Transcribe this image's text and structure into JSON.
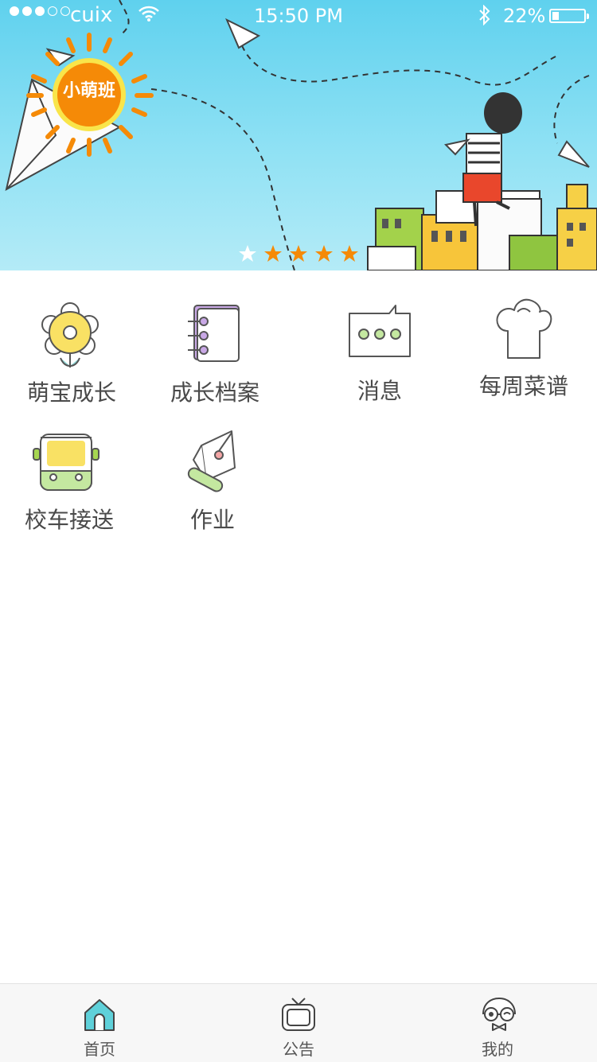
{
  "status_bar": {
    "carrier": "cuix",
    "time": "15:50 PM",
    "battery": "22%",
    "battery_level": 0.22
  },
  "banner": {
    "class_name": "小萌班",
    "pager": {
      "count": 5,
      "active_index": 0
    }
  },
  "menu": [
    {
      "label": "萌宝成长",
      "icon": "flower-icon"
    },
    {
      "label": "成长档案",
      "icon": "notebook-icon"
    },
    {
      "label": "消息",
      "icon": "message-icon"
    },
    {
      "label": "每周菜谱",
      "icon": "chef-hat-icon"
    },
    {
      "label": "校车接送",
      "icon": "school-bus-icon"
    },
    {
      "label": "作业",
      "icon": "pen-icon"
    }
  ],
  "tabbar": [
    {
      "label": "首页",
      "icon": "home-icon",
      "active": true
    },
    {
      "label": "公告",
      "icon": "tv-icon",
      "active": false
    },
    {
      "label": "我的",
      "icon": "profile-face-icon",
      "active": false
    }
  ],
  "colors": {
    "accent": "#f58a07",
    "sun": "#fa8c05",
    "tab_active": "#5fd1da",
    "text": "#4a4a4a"
  }
}
